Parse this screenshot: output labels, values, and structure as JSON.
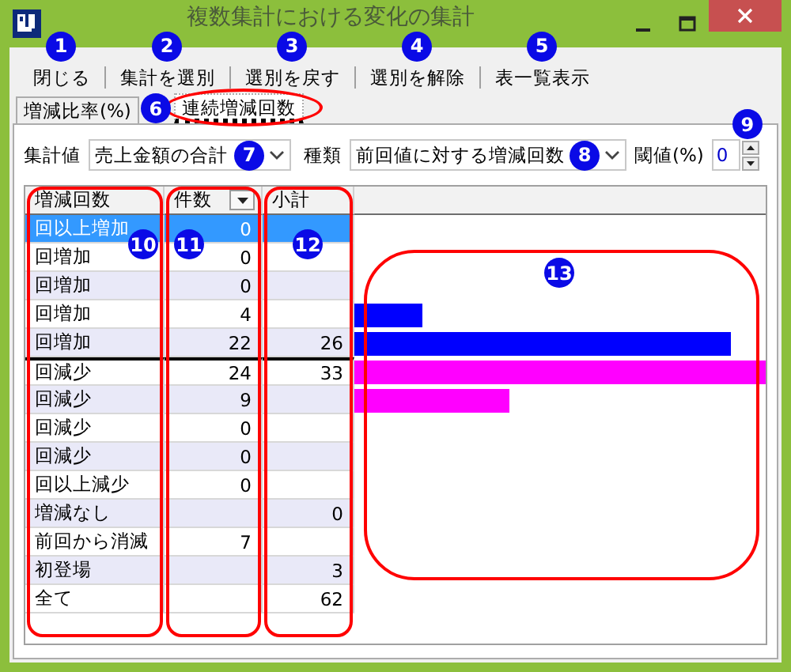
{
  "window": {
    "title": "複数集計における変化の集計"
  },
  "toolbar": [
    {
      "label": "閉じる",
      "callout": "1"
    },
    {
      "label": "集計を選別",
      "callout": "2"
    },
    {
      "label": "選別を戻す",
      "callout": "3"
    },
    {
      "label": "選別を解除",
      "callout": "4"
    },
    {
      "label": "表一覧表示",
      "callout": "5"
    }
  ],
  "tabs": [
    {
      "label": "増減比率(%)",
      "selected": false
    },
    {
      "label": "連続増減回数",
      "selected": true,
      "callout": "6",
      "outlined": true
    }
  ],
  "controls": {
    "value": {
      "label": "集計値",
      "value": "売上金額の合計",
      "callout": "7"
    },
    "kind": {
      "label": "種類",
      "value": "前回値に対する増減回数",
      "callout": "8"
    },
    "threshold": {
      "label": "閾値(%)",
      "value": "0",
      "callout": "9"
    }
  },
  "table": {
    "columns": [
      {
        "label": "増減回数",
        "callout": "10",
        "outlined": true
      },
      {
        "label": "件数",
        "callout": "11",
        "outlined": true,
        "menu": true
      },
      {
        "label": "小計",
        "callout": "12",
        "outlined": true
      }
    ],
    "chart": {
      "callout": "13",
      "outlined": true
    },
    "rows": [
      {
        "label": "回以上増加",
        "count": "0",
        "selected": true
      },
      {
        "label": "回増加",
        "count": "0",
        "selected": false
      },
      {
        "label": "回増加",
        "count": "0",
        "selected": false
      },
      {
        "label": "回増加",
        "count": "4",
        "selected": false,
        "color": "#0000ff"
      },
      {
        "label": "回増加",
        "count": "22",
        "subtotal": "26",
        "selected": false,
        "color": "#0000ff"
      },
      {
        "label": "回減少",
        "count": "24",
        "subtotal": "33",
        "selected": false,
        "color": "#ff00ff",
        "divider_above": true
      },
      {
        "label": "回減少",
        "count": "9",
        "selected": false,
        "color": "#ff00ff"
      },
      {
        "label": "回減少",
        "count": "0",
        "selected": false
      },
      {
        "label": "回減少",
        "count": "0",
        "selected": false
      },
      {
        "label": "回以上減少",
        "count": "0",
        "selected": false
      },
      {
        "label": "増減なし",
        "subtotal": "0",
        "selected": false
      },
      {
        "label": "前回から消滅",
        "count": "7",
        "selected": false
      },
      {
        "label": "初登場",
        "subtotal": "3",
        "selected": false
      },
      {
        "label": "全て",
        "subtotal": "62",
        "selected": false
      }
    ]
  }
}
